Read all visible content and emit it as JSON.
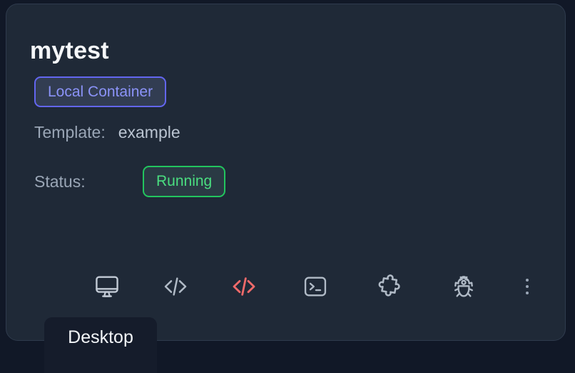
{
  "card": {
    "title": "mytest",
    "type_badge": {
      "label": "Local Container",
      "border_color": "#6366f1",
      "text_color": "#8b93f8"
    },
    "template": {
      "label": "Template:",
      "value": "example"
    },
    "status": {
      "label": "Status:",
      "value": "Running",
      "border_color": "#22c55e",
      "text_color": "#4ade80"
    },
    "background_color": "#1f2937",
    "border_color": "#2f3b4d"
  },
  "toolbar": {
    "actions": [
      {
        "name": "desktop",
        "icon": "monitor-icon",
        "color": "#c3cbd6"
      },
      {
        "name": "open-code",
        "icon": "code-brackets-icon",
        "color": "#b0bac6"
      },
      {
        "name": "open-code-insiders",
        "icon": "code-brackets-icon",
        "color": "#ef6a6a"
      },
      {
        "name": "terminal",
        "icon": "terminal-icon",
        "color": "#b0bac6"
      },
      {
        "name": "extensions",
        "icon": "puzzle-piece-icon",
        "color": "#b0bac6"
      },
      {
        "name": "debug",
        "icon": "bug-icon",
        "color": "#b0bac6"
      }
    ],
    "overflow_menu": {
      "name": "more-options",
      "icon": "kebab-menu-icon",
      "color": "#9aa6b6"
    }
  },
  "tooltip": {
    "text": "Desktop",
    "background_color": "#151c2b"
  },
  "page": {
    "background_color": "#111827"
  }
}
